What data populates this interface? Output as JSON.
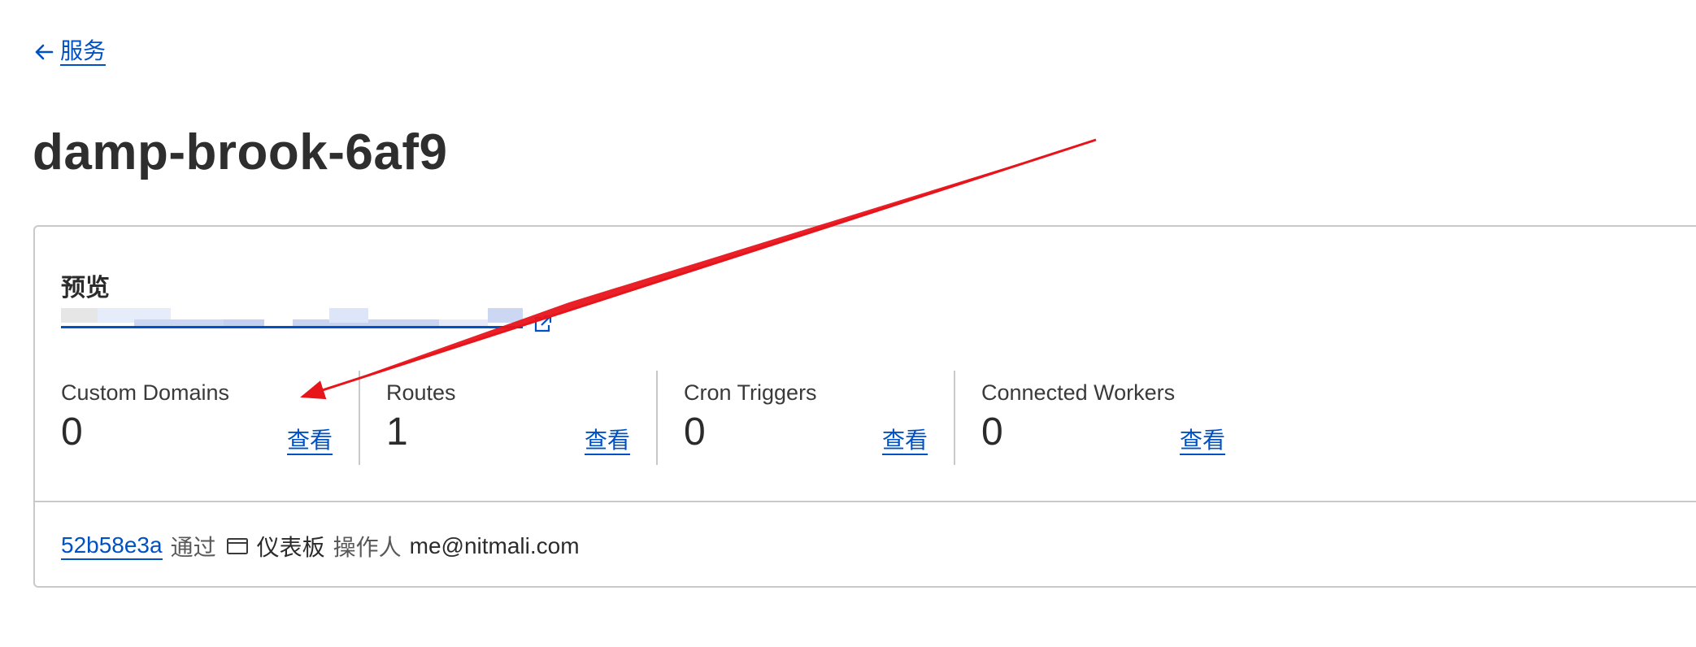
{
  "nav": {
    "back_label": "服务"
  },
  "page": {
    "title": "damp-brook-6af9"
  },
  "preview": {
    "title": "预览"
  },
  "stats": [
    {
      "label": "Custom Domains",
      "value": "0",
      "link": "查看"
    },
    {
      "label": "Routes",
      "value": "1",
      "link": "查看"
    },
    {
      "label": "Cron Triggers",
      "value": "0",
      "link": "查看"
    },
    {
      "label": "Connected Workers",
      "value": "0",
      "link": "查看"
    }
  ],
  "deployment": {
    "commit": "52b58e3a",
    "via": "通过",
    "source": "仪表板",
    "operator_label": "操作人",
    "email": "me@nitmali.com"
  },
  "colors": {
    "link": "#0051c3",
    "border": "#c9c9c9",
    "annotation_arrow": "#e8141b"
  }
}
